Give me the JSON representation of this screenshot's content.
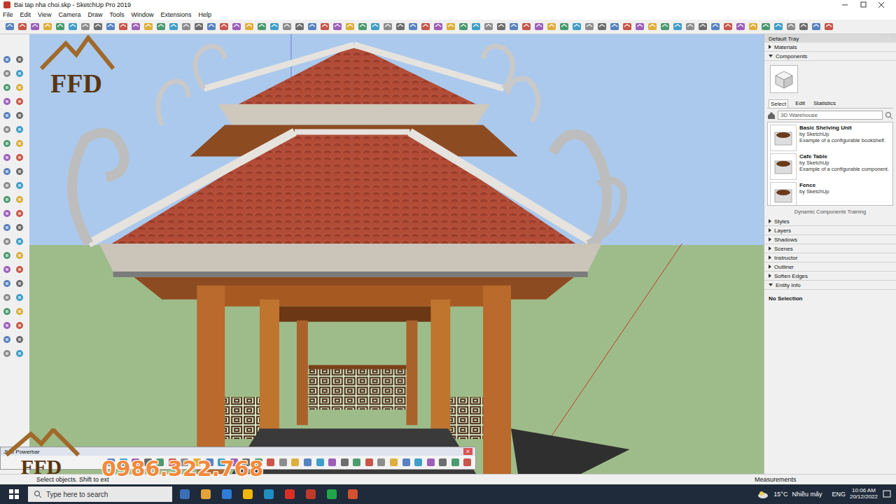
{
  "window": {
    "title": "Bai tap nha choi.skp - SketchUp Pro 2019"
  },
  "menu": [
    "File",
    "Edit",
    "View",
    "Camera",
    "Draw",
    "Tools",
    "Window",
    "Extensions",
    "Help"
  ],
  "tray": {
    "title": "Default Tray",
    "sections": [
      {
        "label": "Materials",
        "expanded": false
      },
      {
        "label": "Components",
        "expanded": true
      }
    ],
    "components": {
      "tabs": [
        {
          "label": "Select",
          "selected": true
        },
        {
          "label": "Edit",
          "selected": false
        },
        {
          "label": "Statistics",
          "selected": false
        }
      ],
      "search": {
        "placeholder": "3D Warehouse"
      },
      "items": [
        {
          "name": "Basic Shelving Unit",
          "author": "by SketchUp",
          "description": "Example of a configurable bookshelf."
        },
        {
          "name": "Cafe Table",
          "author": "by SketchUp",
          "description": "Example of a configurable component."
        },
        {
          "name": "Fence",
          "author": "by SketchUp",
          "description": ""
        }
      ],
      "footer": "Dynamic Components Training"
    },
    "lower_sections": [
      {
        "label": "Styles",
        "expanded": false
      },
      {
        "label": "Layers",
        "expanded": false
      },
      {
        "label": "Shadows",
        "expanded": false
      },
      {
        "label": "Scenes",
        "expanded": false
      },
      {
        "label": "Instructor",
        "expanded": false
      },
      {
        "label": "Outliner",
        "expanded": false
      },
      {
        "label": "Soften Edges",
        "expanded": false
      },
      {
        "label": "Entity Info",
        "expanded": true
      }
    ],
    "entity_info": "No Selection"
  },
  "powerbar": {
    "title": "JHS Powerbar",
    "close": "×"
  },
  "status_bar": {
    "hint": "Select objects. Shift to ext",
    "measurements": "Measurements"
  },
  "watermark": {
    "logo": "FFD",
    "phone": "0986.322.768"
  },
  "taskbar": {
    "search": "Type here to search",
    "temperature": "15°C",
    "weather": "Nhiều mây",
    "language": "ENG",
    "time": "10:06 AM",
    "date": "20/12/2022"
  }
}
